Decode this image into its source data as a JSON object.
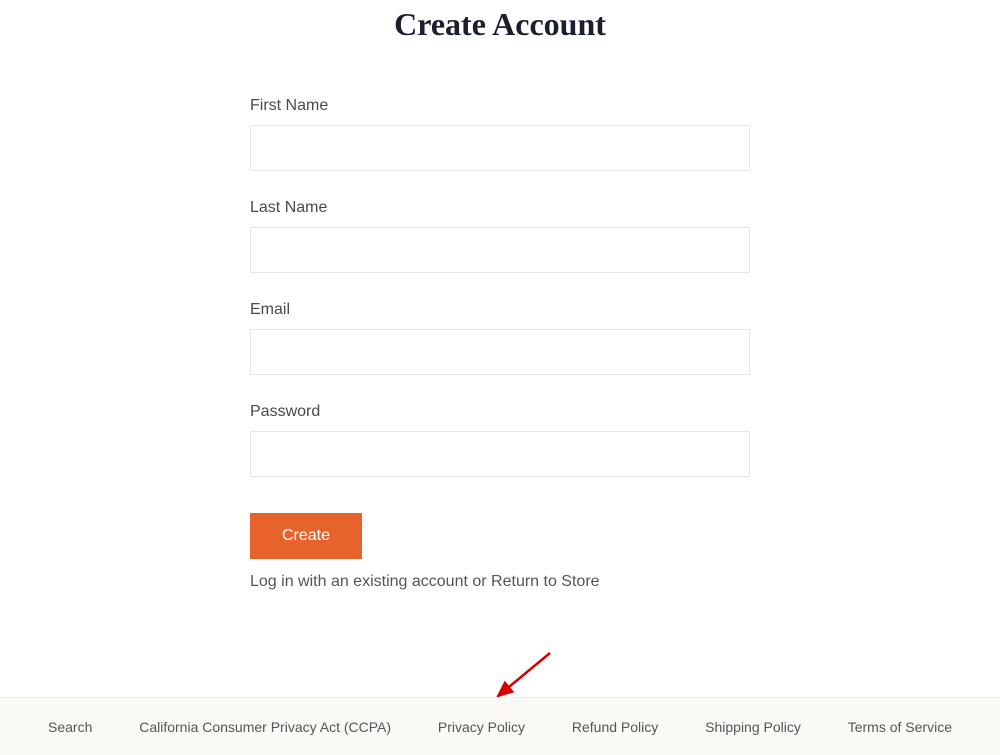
{
  "title": "Create Account",
  "form": {
    "first_name_label": "First Name",
    "last_name_label": "Last Name",
    "email_label": "Email",
    "password_label": "Password",
    "create_button": "Create"
  },
  "login_row": {
    "login_link": "Log in with an existing account",
    "separator": " or ",
    "return_link": "Return to Store"
  },
  "footer": {
    "links": [
      "Search",
      "California Consumer Privacy Act (CCPA)",
      "Privacy Policy",
      "Refund Policy",
      "Shipping Policy",
      "Terms of Service"
    ]
  }
}
